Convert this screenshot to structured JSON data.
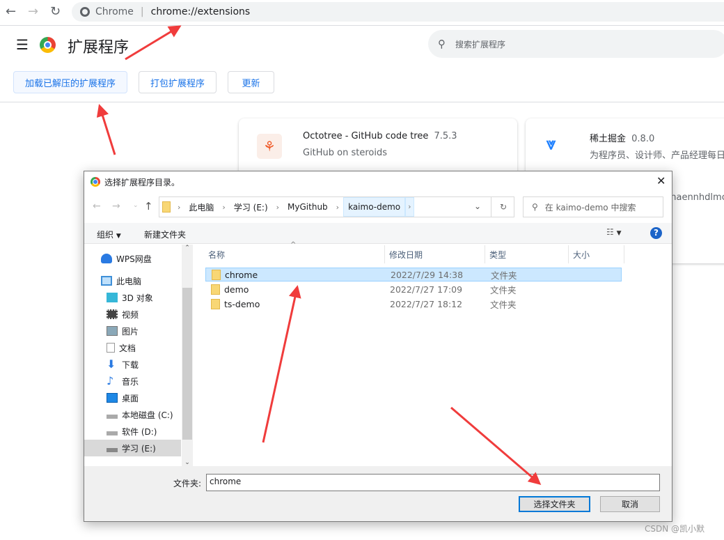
{
  "browser": {
    "omnibox_site": "Chrome",
    "omnibox_url": "chrome://extensions"
  },
  "header": {
    "title": "扩展程序",
    "search_placeholder": "搜索扩展程序"
  },
  "toolbar": {
    "load_unpacked": "加载已解压的扩展程序",
    "pack": "打包扩展程序",
    "update": "更新"
  },
  "cards": [
    {
      "name": "Octotree - GitHub code tree",
      "version": "7.5.3",
      "description": "GitHub on steroids",
      "icon": "octotree-icon"
    },
    {
      "name": "稀土掘金",
      "version": "0.8.0",
      "description": "为程序员、设计师、产品经理每日",
      "id_fragment": "nhaennhdlmc",
      "icon": "juejin-icon"
    }
  ],
  "dialog": {
    "title": "选择扩展程序目录。",
    "breadcrumb": [
      "此电脑",
      "学习 (E:)",
      "MyGithub",
      "kaimo-demo"
    ],
    "search_placeholder": "在 kaimo-demo 中搜索",
    "organize": "组织",
    "new_folder": "新建文件夹",
    "nav": [
      "WPS网盘",
      "此电脑",
      "3D 对象",
      "视频",
      "图片",
      "文档",
      "下载",
      "音乐",
      "桌面",
      "本地磁盘 (C:)",
      "软件 (D:)",
      "学习 (E:)"
    ],
    "nav_selected": "学习 (E:)",
    "columns": [
      "名称",
      "修改日期",
      "类型",
      "大小"
    ],
    "files": [
      {
        "name": "chrome",
        "date": "2022/7/29 14:38",
        "type": "文件夹",
        "selected": true
      },
      {
        "name": "demo",
        "date": "2022/7/27 17:09",
        "type": "文件夹"
      },
      {
        "name": "ts-demo",
        "date": "2022/7/27 18:12",
        "type": "文件夹"
      }
    ],
    "folder_label": "文件夹:",
    "folder_value": "chrome",
    "select_button": "选择文件夹",
    "cancel_button": "取消"
  },
  "watermark": "CSDN @凯小默",
  "colors": {
    "accent": "#1a73e8",
    "selection": "#cce8ff",
    "annotation_arrow": "#f03c3c"
  }
}
